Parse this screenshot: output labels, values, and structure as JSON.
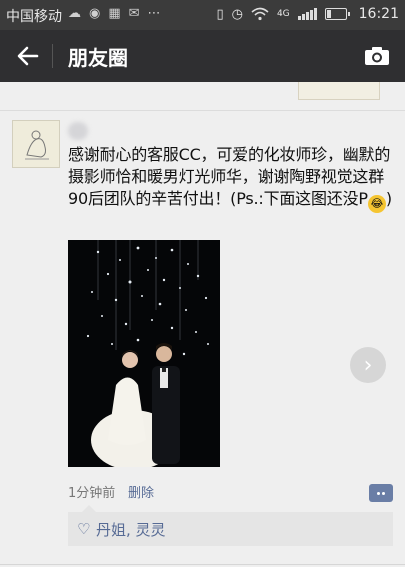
{
  "status_bar": {
    "carrier": "中国移动",
    "network": "4G",
    "time": "16:21"
  },
  "nav": {
    "title": "朋友圈"
  },
  "post": {
    "text": "感谢耐心的客服CC，可爱的化妆师珍，幽默的摄影师恰和暖男灯光师华，谢谢陶野视觉这群90后团队的辛苦付出！(Ps.:下面这图还没P",
    "text_end": ")",
    "time_ago": "1分钟前",
    "delete_label": "删除",
    "likes": "丹姐, 灵灵"
  },
  "icons": {
    "back": "arrow-left-icon",
    "camera": "camera-icon",
    "heart": "heart-icon",
    "comment": "comment-icon",
    "next": "chevron-right-icon"
  },
  "colors": {
    "nav_bg": "#2f2f31",
    "status_bg": "#3b3b3b",
    "link": "#576b95",
    "background": "#efefef"
  }
}
